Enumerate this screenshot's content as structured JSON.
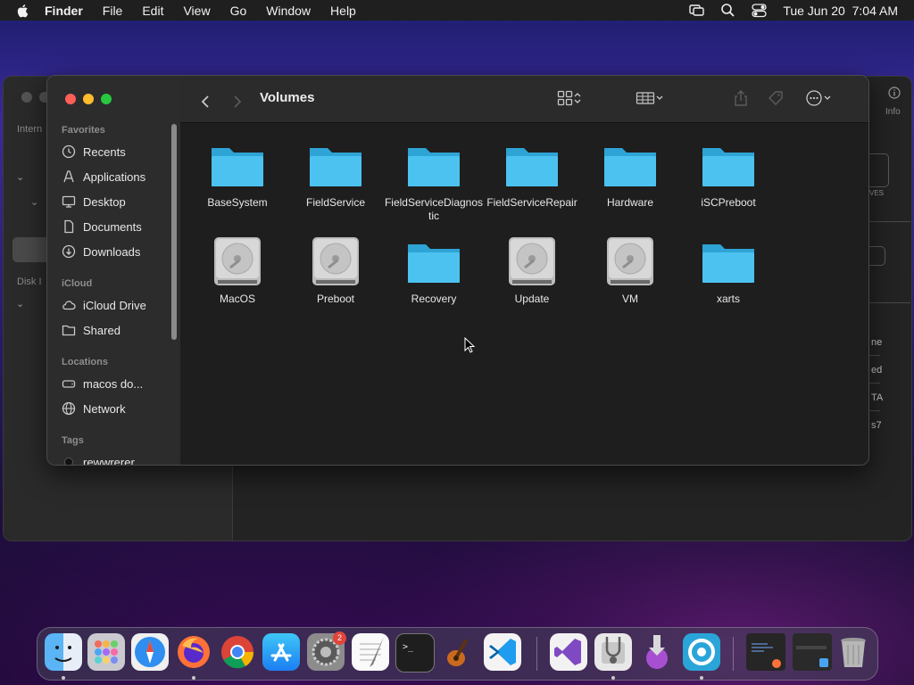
{
  "menubar": {
    "app_name": "Finder",
    "items": [
      "File",
      "Edit",
      "View",
      "Go",
      "Window",
      "Help"
    ],
    "clock": "Tue Jun 20  7:04 AM"
  },
  "background_window": {
    "labels": [
      "Intern",
      "Disk I",
      "Info"
    ],
    "right_texts": [
      "VES",
      "ne",
      "ed",
      "TA",
      "s7"
    ]
  },
  "finder": {
    "title": "Volumes",
    "sidebar": {
      "sections": [
        {
          "title": "Favorites",
          "items": [
            {
              "label": "Recents",
              "icon": "clock-icon"
            },
            {
              "label": "Applications",
              "icon": "applications-icon"
            },
            {
              "label": "Desktop",
              "icon": "desktop-icon"
            },
            {
              "label": "Documents",
              "icon": "document-icon"
            },
            {
              "label": "Downloads",
              "icon": "download-icon"
            }
          ]
        },
        {
          "title": "iCloud",
          "items": [
            {
              "label": "iCloud Drive",
              "icon": "cloud-icon"
            },
            {
              "label": "Shared",
              "icon": "shared-folder-icon"
            }
          ]
        },
        {
          "title": "Locations",
          "items": [
            {
              "label": "macos do...",
              "icon": "disk-icon"
            },
            {
              "label": "Network",
              "icon": "globe-icon"
            }
          ]
        },
        {
          "title": "Tags",
          "items": [
            {
              "label": "rewwrerer",
              "icon": "tag-dot-icon"
            }
          ]
        }
      ]
    },
    "items": [
      {
        "name": "BaseSystem",
        "icon": "folder-icon"
      },
      {
        "name": "FieldService",
        "icon": "folder-icon"
      },
      {
        "name": "FieldServiceDiagnostic",
        "icon": "folder-icon"
      },
      {
        "name": "FieldServiceRepair",
        "icon": "folder-icon"
      },
      {
        "name": "Hardware",
        "icon": "folder-icon"
      },
      {
        "name": "iSCPreboot",
        "icon": "folder-icon"
      },
      {
        "name": "MacOS",
        "icon": "hard-drive-icon"
      },
      {
        "name": "Preboot",
        "icon": "hard-drive-icon"
      },
      {
        "name": "Recovery",
        "icon": "folder-icon"
      },
      {
        "name": "Update",
        "icon": "hard-drive-icon"
      },
      {
        "name": "VM",
        "icon": "hard-drive-icon"
      },
      {
        "name": "xarts",
        "icon": "folder-icon"
      }
    ]
  },
  "dock": {
    "apps": [
      "finder-icon",
      "launchpad-icon",
      "safari-icon",
      "firefox-icon",
      "chrome-icon",
      "app-store-icon",
      "system-preferences-icon",
      "textedit-icon",
      "terminal-icon",
      "garageband-icon",
      "vscode-icon",
      "visual-studio-icon",
      "disk-utility-icon",
      "installer-icon",
      "app-icon",
      "window-thumbnail-icon",
      "window-thumbnail-icon",
      "trash-icon"
    ],
    "system_preferences_badge": "2"
  },
  "colors": {
    "folder": "#3fb8e8",
    "close": "#ff5f57",
    "minimize": "#febc2e",
    "zoom": "#28c840"
  }
}
